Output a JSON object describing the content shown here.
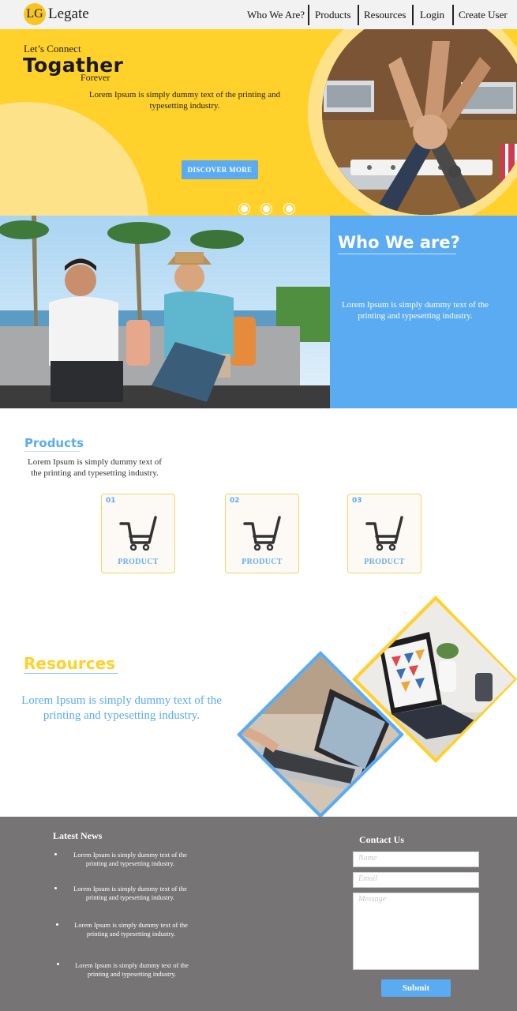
{
  "nav": {
    "logo_initials": "LG",
    "logo_name": "Legate",
    "items": [
      {
        "label": "Who We Are?"
      },
      {
        "label": "Products"
      },
      {
        "label": "Resources"
      },
      {
        "label": "Login"
      },
      {
        "label": "Create User"
      }
    ]
  },
  "hero": {
    "line1": "Let’s Connect",
    "line2": "Togather",
    "line3": "Forever",
    "description": "Lorem Ipsum is simply dummy text of the printing and typesetting industry.",
    "cta_label": "DISCOVER MORE",
    "slides": 3
  },
  "who": {
    "title": "Who We are?",
    "description": "Lorem Ipsum is simply dummy text of the printing and typesetting industry."
  },
  "products": {
    "title": "Products",
    "description": "Lorem Ipsum is simply dummy text of the printing and typesetting industry.",
    "cards": [
      {
        "number": "01",
        "label": "PRODUCT",
        "icon": "cart-icon"
      },
      {
        "number": "02",
        "label": "PRODUCT",
        "icon": "cart-icon"
      },
      {
        "number": "03",
        "label": "PRODUCT",
        "icon": "cart-icon"
      }
    ]
  },
  "resources": {
    "title": "Resources",
    "description": "Lorem Ipsum is simply dummy text of the printing and typesetting industry."
  },
  "footer": {
    "news_title": "Latest News",
    "news_items": [
      "Lorem Ipsum is simply dummy text of the printing and typesetting industry.",
      "Lorem Ipsum is simply dummy text of the printing and typesetting industry.",
      "Lorem Ipsum is simply dummy text of the printing and typesetting industry.",
      "Lorem Ipsum is simply dummy text of the printing and typesetting industry."
    ],
    "contact_title": "Contact Us",
    "name_placeholder": "Name",
    "email_placeholder": "Email",
    "message_placeholder": "Message",
    "submit_label": "Submit"
  },
  "colors": {
    "yellow": "#ffd12a",
    "light_yellow": "#fde28a",
    "blue": "#5aabf2",
    "footer_gray": "#767474"
  }
}
